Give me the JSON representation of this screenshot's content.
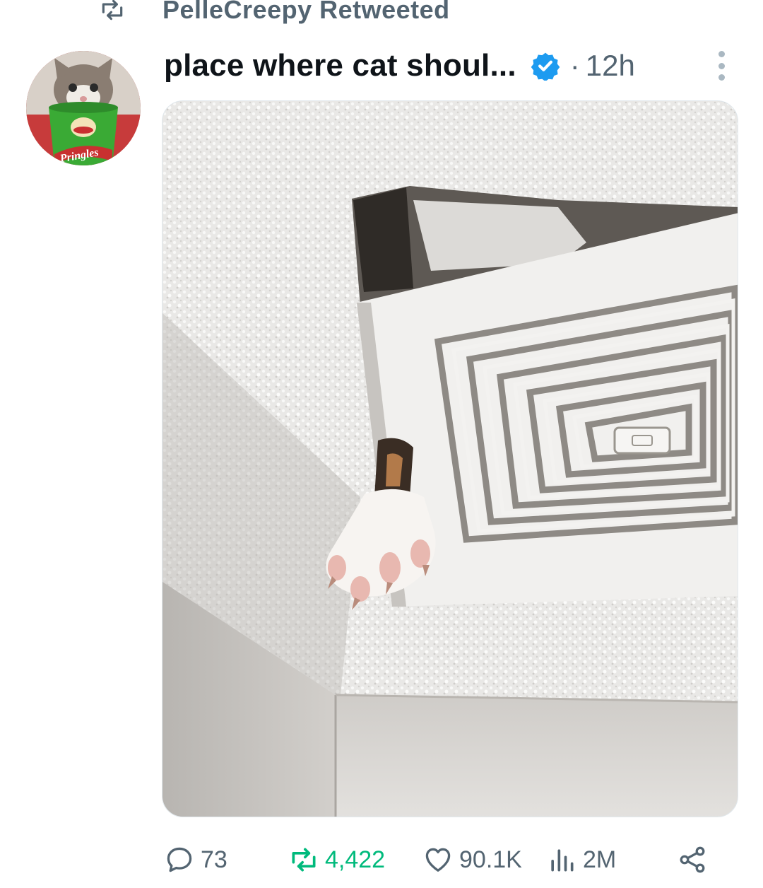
{
  "retweet_context": {
    "text": "PelleCreepy Retweeted",
    "icon": "retweet-icon"
  },
  "tweet": {
    "author_name": "place where cat shoul...",
    "verified": true,
    "separator": "·",
    "time": "12h",
    "avatar_logo_text": "Pringles"
  },
  "actions": {
    "replies": "73",
    "retweets": "4,422",
    "likes": "90.1K",
    "views": "2M"
  },
  "colors": {
    "text_primary": "#0f1419",
    "text_secondary": "#536471",
    "retweet_active": "#00ba7c",
    "verified_blue": "#1d9bf0"
  }
}
